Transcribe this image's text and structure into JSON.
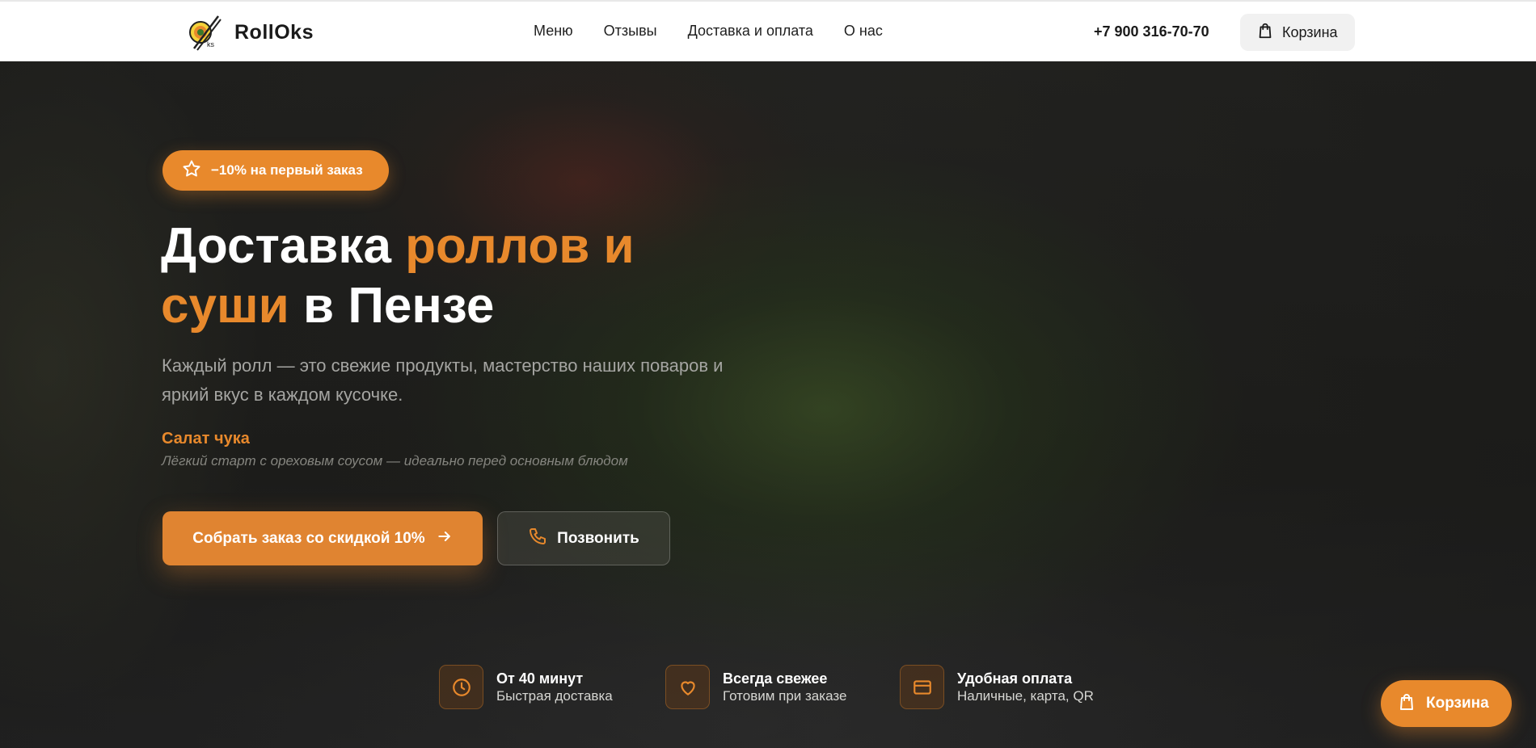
{
  "header": {
    "logo_text": "RollOks",
    "logo_mark_text": "ROKS",
    "nav": [
      "Меню",
      "Отзывы",
      "Доставка и оплата",
      "О нас"
    ],
    "phone": "+7 900 316-70-70",
    "cart_label": "Корзина"
  },
  "hero": {
    "promo": "−10% на первый заказ",
    "title_part1": "Доставка ",
    "title_accent1": "роллов и суши",
    "title_part2": " в Пензе",
    "subtitle": "Каждый ролл — это свежие продукты, мастерство наших поваров и яркий вкус в каждом кусочке.",
    "dish_name": "Салат чука",
    "dish_desc": "Лёгкий старт с ореховым соусом — идеально перед основным блюдом",
    "cta_primary": "Собрать заказ со скидкой 10%",
    "cta_secondary": "Позвонить"
  },
  "features": [
    {
      "title": "От 40 минут",
      "subtitle": "Быстрая доставка",
      "icon": "clock-icon"
    },
    {
      "title": "Всегда свежее",
      "subtitle": "Готовим при заказе",
      "icon": "heart-icon"
    },
    {
      "title": "Удобная оплата",
      "subtitle": "Наличные, карта, QR",
      "icon": "credit-card-icon"
    }
  ],
  "floating_cart": {
    "label": "Корзина"
  },
  "colors": {
    "accent": "#e8892c",
    "header_bg": "#ffffff",
    "text_dark": "#1a1a1a"
  }
}
